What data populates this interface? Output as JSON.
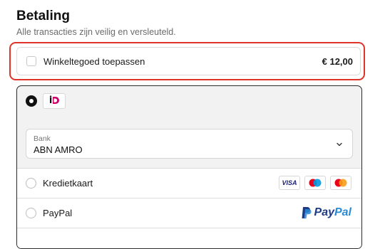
{
  "header": {
    "title": "Betaling",
    "subtitle": "Alle transacties zijn veilig en versleuteld."
  },
  "store_credit": {
    "label": "Winkeltegoed toepassen",
    "amount": "€ 12,00",
    "checked": false,
    "highlight_color": "#e0342b"
  },
  "payment_methods": {
    "selected": "ideal",
    "ideal": {
      "logo_icon": "ideal-logo-icon",
      "bank_field": {
        "label": "Bank",
        "value": "ABN AMRO"
      }
    },
    "creditcard": {
      "label": "Kredietkaart",
      "visa_text": "VISA",
      "icons": [
        "visa-icon",
        "maestro-icon",
        "mastercard-icon"
      ]
    },
    "paypal": {
      "label": "PayPal",
      "logo_pay": "Pay",
      "logo_pal": "Pal"
    }
  }
}
